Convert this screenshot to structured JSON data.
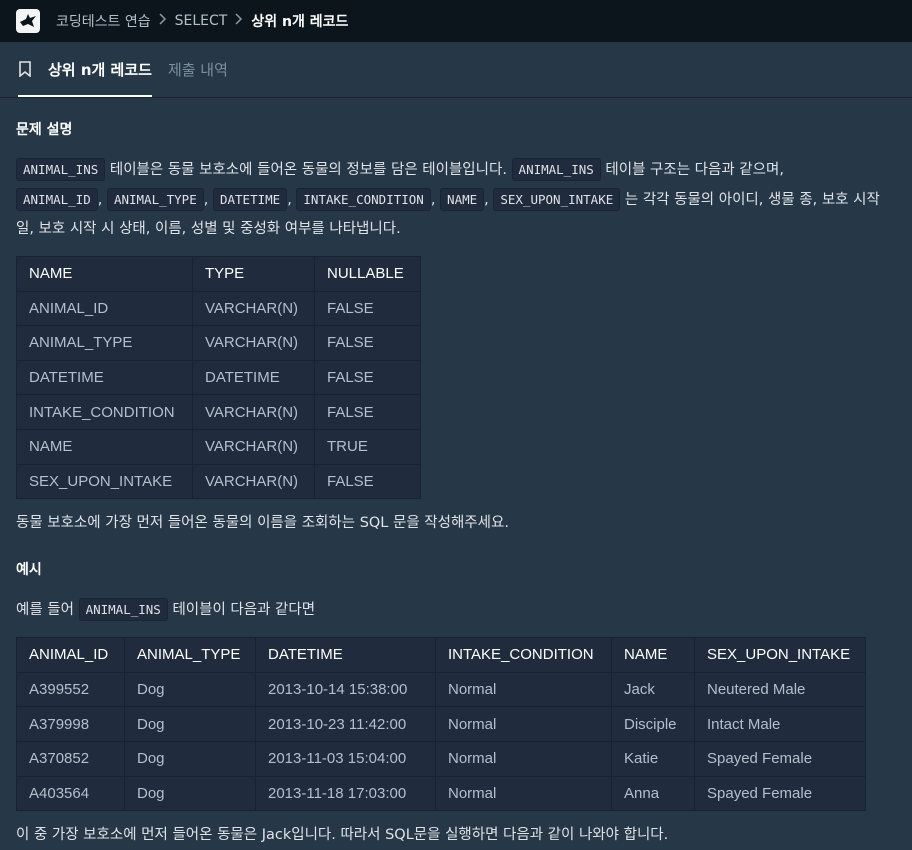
{
  "breadcrumb": {
    "items": [
      "코딩테스트 연습",
      "SELECT",
      "상위 n개 레코드"
    ]
  },
  "tabs": [
    {
      "label": "상위 n개 레코드",
      "active": true
    },
    {
      "label": "제출 내역",
      "active": false
    }
  ],
  "section1": {
    "title": "문제 설명",
    "p1": {
      "c1": "ANIMAL_INS",
      "t1": " 테이블은 동물 보호소에 들어온 동물의 정보를 담은 테이블입니다. ",
      "c2": "ANIMAL_INS",
      "t2": " 테이블 구조는 다음과 같으며,",
      "c3": "ANIMAL_ID",
      "c4": "ANIMAL_TYPE",
      "c5": "DATETIME",
      "c6": "INTAKE_CONDITION",
      "c7": "NAME",
      "c8": "SEX_UPON_INTAKE",
      "comma": ", ",
      "t3": " 는 각각 동물의 아이디, 생물 종, 보호 시작일, 보호 시작 시 상태, 이름, 성별 및 중성화 여부를 나타냅니다."
    },
    "schema_headers": [
      "NAME",
      "TYPE",
      "NULLABLE"
    ],
    "schema_rows": [
      [
        "ANIMAL_ID",
        "VARCHAR(N)",
        "FALSE"
      ],
      [
        "ANIMAL_TYPE",
        "VARCHAR(N)",
        "FALSE"
      ],
      [
        "DATETIME",
        "DATETIME",
        "FALSE"
      ],
      [
        "INTAKE_CONDITION",
        "VARCHAR(N)",
        "FALSE"
      ],
      [
        "NAME",
        "VARCHAR(N)",
        "TRUE"
      ],
      [
        "SEX_UPON_INTAKE",
        "VARCHAR(N)",
        "FALSE"
      ]
    ],
    "p2": "동물 보호소에 가장 먼저 들어온 동물의 이름을 조회하는 SQL 문을 작성해주세요."
  },
  "section2": {
    "title": "예시",
    "p1_a": "예를 들어 ",
    "p1_code": "ANIMAL_INS",
    "p1_b": " 테이블이 다음과 같다면",
    "example_headers": [
      "ANIMAL_ID",
      "ANIMAL_TYPE",
      "DATETIME",
      "INTAKE_CONDITION",
      "NAME",
      "SEX_UPON_INTAKE"
    ],
    "example_rows": [
      [
        "A399552",
        "Dog",
        "2013-10-14 15:38:00",
        "Normal",
        "Jack",
        "Neutered Male"
      ],
      [
        "A379998",
        "Dog",
        "2013-10-23 11:42:00",
        "Normal",
        "Disciple",
        "Intact Male"
      ],
      [
        "A370852",
        "Dog",
        "2013-11-03 15:04:00",
        "Normal",
        "Katie",
        "Spayed Female"
      ],
      [
        "A403564",
        "Dog",
        "2013-11-18 17:03:00",
        "Normal",
        "Anna",
        "Spayed Female"
      ]
    ],
    "p2": "이 중 가장 보호소에 먼저 들어온 동물은 Jack입니다. 따라서 SQL문을 실행하면 다음과 같이 나와야 합니다."
  },
  "icons": {
    "logo": "bird-logo-icon",
    "bookmark": "bookmark-icon",
    "separator": "chevron-right-icon"
  },
  "colors": {
    "background": "#263747",
    "topbar": "#0c151c",
    "table_bg": "#202b3d"
  }
}
